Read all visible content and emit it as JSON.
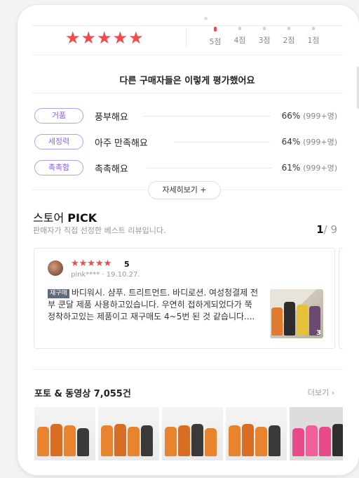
{
  "rating": {
    "stars": "★★★★★",
    "distribution": [
      {
        "label": "5점"
      },
      {
        "label": "4점"
      },
      {
        "label": "3점"
      },
      {
        "label": "2점"
      },
      {
        "label": "1점"
      }
    ]
  },
  "evaluation": {
    "heading": "다른 구매자들은 이렇게 평가했어요",
    "items": [
      {
        "tag": "거품",
        "text": "풍부해요",
        "percent": "66%",
        "count": "(999+명)"
      },
      {
        "tag": "세정력",
        "text": "아주 만족해요",
        "percent": "64%",
        "count": "(999+명)"
      },
      {
        "tag": "촉촉함",
        "text": "촉촉해요",
        "percent": "61%",
        "count": "(999+명)"
      }
    ],
    "more_label": "자세히보기 +"
  },
  "store_pick": {
    "title_prefix": "스토어",
    "title_bold": "PICK",
    "subtitle": "판매자가 직접 선정한 베스트 리뷰입니다.",
    "page_current": "1",
    "page_total": "/ 9",
    "review": {
      "stars": "★★★★★",
      "score": "5",
      "user": "pink****",
      "date": "· 19.10.27.",
      "badge": "재구매",
      "text": "바디워시. 샴푸. 트리트먼트. 바디로션. 여성청결제 전부 쿤달 제품 사용하고있습니다. 우연히 접하게되었다가 쭉 정착하고있는 제품이고 재구매도 4~5번 된 것 같습니다....",
      "photo_count": "3"
    }
  },
  "photos": {
    "title": "포토 & 동영상 7,055건",
    "more_label": "더보기 ›"
  },
  "colors": {
    "accent_red": "#f24b4b",
    "tag_purple": "#8a63e8"
  }
}
